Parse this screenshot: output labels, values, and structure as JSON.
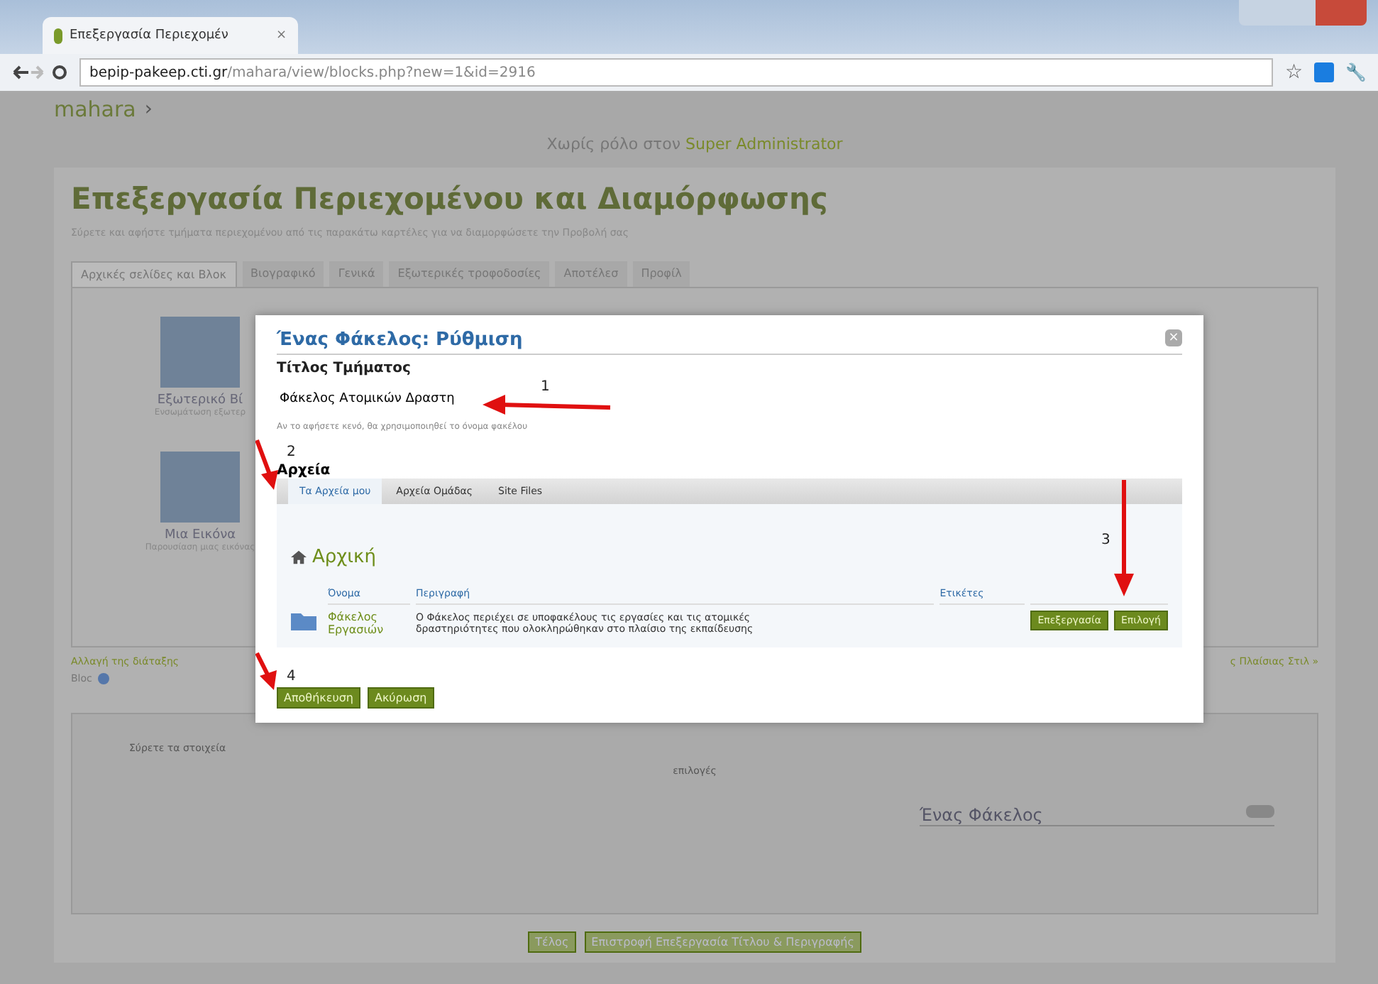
{
  "browser": {
    "tab_title": "Επεξεργασία Περιεχομέν",
    "tab_close": "×",
    "url_host": "bepip-pakeep.cti.gr",
    "url_path": "/mahara/view/blocks.php?new=1&id=2916"
  },
  "site": {
    "logo": "mahara",
    "logo_caret": "›",
    "role_prefix": "Χωρίς ρόλο στον",
    "role_user": "Super Administrator"
  },
  "page": {
    "title": "Επεξεργασία Περιεχομένου και Διαμόρφωσης",
    "subtitle": "Σύρετε και αφήστε τμήματα περιεχομένου από τις παρακάτω καρτέλες για να διαμορφώσετε την Προβολή σας",
    "tabs": [
      {
        "label": "Αρχικές σελίδες και Βλοκ",
        "selected": true
      },
      {
        "label": "Βιογραφικό",
        "selected": false
      },
      {
        "label": "Γενικά",
        "selected": false
      },
      {
        "label": "Εξωτερικές τροφοδοσίες",
        "selected": false
      },
      {
        "label": "Αποτέλεσ",
        "selected": false
      },
      {
        "label": "Προφίλ",
        "selected": false
      }
    ],
    "blocks": [
      {
        "name": "Εξωτερικό Βί",
        "desc": "Ενσωμάτωση εξωτερ"
      },
      {
        "name": "Μια Εικόνα",
        "desc": "Παρουσίαση μιας εικόνας"
      }
    ],
    "layout_link": "Αλλαγή της διάταξης",
    "layout_right": "ς Πλαίσιας Στιλ »",
    "bloc": "Bloc",
    "drop_hint": "Σύρετε τα στοιχεία",
    "drop_hint_end": "επιλογές",
    "placed_block": "Ένας Φάκελος",
    "buttons": [
      "Τέλος",
      "Επιστροφή Επεξεργασία Τίτλου & Περιγραφής"
    ]
  },
  "dialog": {
    "title": "Ένας Φάκελος: Ρύθμιση",
    "close": "×",
    "field_label": "Τίτλος Τμήματος",
    "field_value": "Φάκελος Ατομικών Δραστη",
    "field_hint": "Αν το αφήσετε κενό, θα χρησιμοποιηθεί το όνομα φακέλου",
    "files_label": "Αρχεία",
    "tabs": [
      {
        "label": "Τα Αρχεία μου",
        "selected": true
      },
      {
        "label": "Αρχεία Ομάδας",
        "selected": false
      },
      {
        "label": "Site Files",
        "selected": false
      }
    ],
    "folder": "Αρχική",
    "columns": [
      "Όνομα",
      "Περιγραφή",
      "Ετικέτες"
    ],
    "rows": [
      {
        "name": "Φάκελος Εργασιών",
        "description": "Ο Φάκελος περιέχει σε υποφακέλους τις εργασίες και τις ατομικές δραστηριότητες που ολοκληρώθηκαν στο πλαίσιο της εκπαίδευσης",
        "actions": [
          "Επεξεργασία",
          "Επιλογή"
        ]
      }
    ],
    "buttons": [
      "Αποθήκευση",
      "Ακύρωση"
    ]
  },
  "annotations": [
    "1",
    "2",
    "3",
    "4"
  ],
  "toolbar": {
    "star": "☆",
    "wrench": "🔧"
  }
}
